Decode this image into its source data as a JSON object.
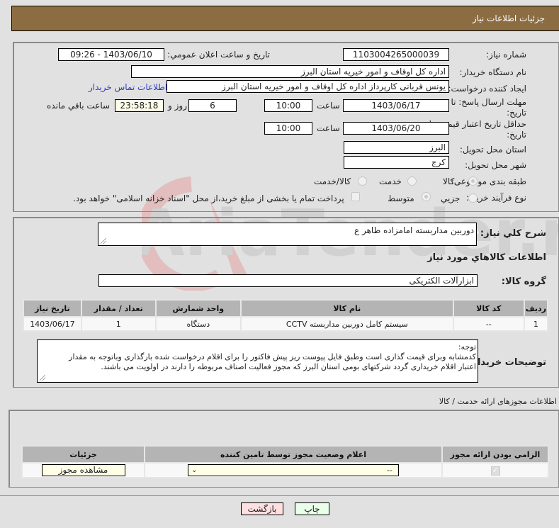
{
  "header": {
    "title": "جزئیات اطلاعات نیاز"
  },
  "form": {
    "need_number": {
      "label": "شماره نیاز:",
      "value": "1103004265000039"
    },
    "announce": {
      "label": "تاریخ و ساعت اعلان عمومي:",
      "value": "1403/06/10 - 09:26"
    },
    "buyer_org": {
      "label": "نام دستگاه خریدار:",
      "value": "اداره کل اوقاف و امور خیریه استان البرز"
    },
    "requester": {
      "label": "ایجاد کننده درخواست:",
      "value": "یونس قربانی کارپرداز اداره کل اوقاف و امور خیریه استان البرز"
    },
    "buyer_contact_link": "اطلاعات تماس خریدار",
    "reply_deadline": {
      "label_line1": "مهلت ارسال پاسخ: تا",
      "label_line2": "تاریخ:",
      "date": "1403/06/17",
      "time_label": "ساعت",
      "time": "10:00",
      "days": "6",
      "days_label": "روز و",
      "remaining": "23:58:18",
      "remaining_label": "ساعت باقي مانده"
    },
    "price_validity": {
      "label_line1": "حداقل تاریخ اعتبار قیمت: تا",
      "label_line2": "تاریخ:",
      "date": "1403/06/20",
      "time_label": "ساعت",
      "time": "10:00"
    },
    "province": {
      "label": "استان محل تحویل:",
      "value": "البرز"
    },
    "city": {
      "label": "شهر محل تحویل:",
      "value": "کرج"
    },
    "category": {
      "label": "طبقه بندی موضوعی:",
      "options": [
        {
          "label": "کالا",
          "selected": true
        },
        {
          "label": "خدمت",
          "selected": false
        },
        {
          "label": "کالا/خدمت",
          "selected": false
        }
      ]
    },
    "purchase_type": {
      "label": "نوع فرآیند خرید :",
      "options": [
        {
          "label": "جزیي",
          "selected": false
        },
        {
          "label": "متوسط",
          "selected": true
        }
      ],
      "treasury_checkbox": "پرداخت تمام یا بخشی از مبلغ خرید،از محل \"اسناد خزانه اسلامی\" خواهد بود."
    }
  },
  "description": {
    "label": "شرح کلي نياز:",
    "value": "دوربین مداربسته امامزاده طاهر ع"
  },
  "goods_section": {
    "title": "اطلاعات کالاهاي مورد نياز"
  },
  "goods_group": {
    "label": "گروه کالا:",
    "value": "ابزارآلات الکتریکی"
  },
  "goods_table": {
    "headers": [
      "ردیف",
      "کد کالا",
      "نام کالا",
      "واحد شمارش",
      "تعداد / مقدار",
      "تاریخ نیاز"
    ],
    "rows": [
      [
        "1",
        "--",
        "سیستم کامل دوربین مداربسته CCTV",
        "دستگاه",
        "1",
        "1403/06/17"
      ]
    ]
  },
  "buyer_notes": {
    "label": "توضیحات خریدار:",
    "line1": "توجه:",
    "line2": "کدمشابه وبرای قیمت گذاری است وطبق فایل پیوست ریز پیش فاکتور را برای اقلام درخواست شده بارگذاری وباتوجه به مقدار",
    "line3": "اعتبار اقلام خریداری گردد شرکتهای بومی استان البرز که مجوز فعالیت اصناف مربوطه را دارند در اولویت می باشند."
  },
  "license_section": {
    "title": "اطلاعات مجوزهای ارائه خدمت / کالا",
    "headers": [
      "الزامي بودن ارائه مجوز",
      "اعلام وضعیت مجوز توسط تامین کننده",
      "جزئیات"
    ],
    "row": {
      "required_checked": true,
      "status_value": "--",
      "details_button": "مشاهده مجوز"
    }
  },
  "footer": {
    "print_button": "چاپ",
    "back_button": "بازگشت"
  },
  "watermark": {
    "text": "AriaTender.neT"
  },
  "colors": {
    "header": "#8c6d42",
    "print_bg": "#eaffea",
    "back_bg": "#ffe0e0"
  }
}
